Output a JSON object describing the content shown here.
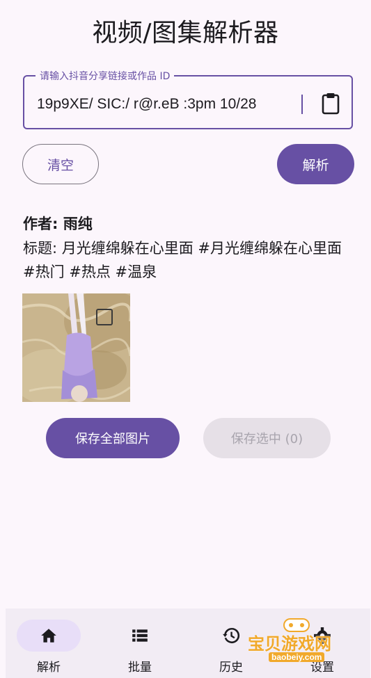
{
  "header": {
    "title": "视频/图集解析器"
  },
  "input": {
    "label": "请输入抖音分享链接或作品 ID",
    "value": "19p9XE/ SIC:/ r@r.eB :3pm 10/28"
  },
  "actions": {
    "clear_label": "清空",
    "parse_label": "解析"
  },
  "result": {
    "author": "作者: 雨纯",
    "title": "标题: 月光缠绵躲在心里面 #月光缠绵躲在心里面 #热门 #热点 #温泉",
    "images": [
      {
        "selected": false
      }
    ]
  },
  "save": {
    "save_all_label": "保存全部图片",
    "save_selected_label": "保存选中 (0)"
  },
  "nav": {
    "items": [
      {
        "label": "解析",
        "icon": "home-icon",
        "active": true
      },
      {
        "label": "批量",
        "icon": "list-icon",
        "active": false
      },
      {
        "label": "历史",
        "icon": "history-icon",
        "active": false
      },
      {
        "label": "设置",
        "icon": "gear-icon",
        "active": false
      }
    ]
  },
  "watermark": {
    "text": "宝贝游戏网",
    "sub": "baobeiy.com"
  },
  "colors": {
    "primary": "#6750a4",
    "background": "#fcf6fc",
    "nav_background": "#f2ecf4",
    "nav_active_pill": "#e8def8",
    "disabled_bg": "#e6e0e7",
    "watermark": "#f1a92b"
  }
}
